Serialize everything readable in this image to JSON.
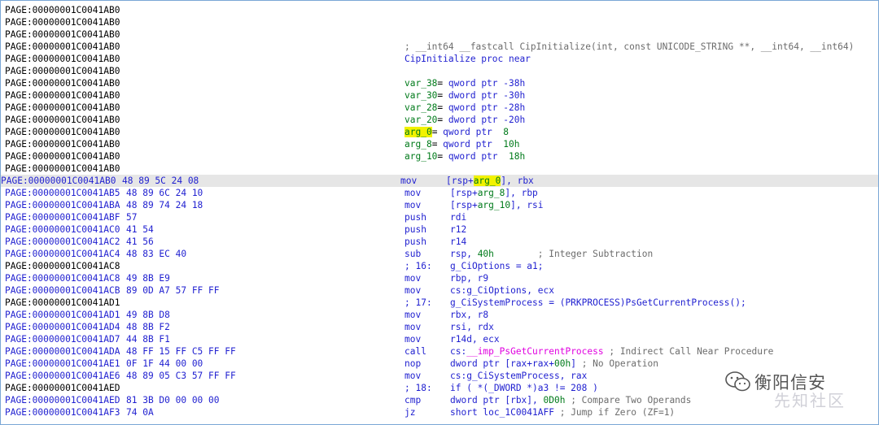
{
  "lines": [
    {
      "addr": "PAGE:00000001C0041AB0",
      "bytes": "",
      "cols": []
    },
    {
      "addr": "PAGE:00000001C0041AB0",
      "bytes": "",
      "cols": []
    },
    {
      "addr": "PAGE:00000001C0041AB0",
      "bytes": "",
      "cols": []
    },
    {
      "addr": "PAGE:00000001C0041AB0",
      "bytes": "",
      "cols": [
        {
          "col": "a",
          "parts": [
            {
              "t": "; __int64 __fastcall CipInitialize(int, const UNICODE_STRING **, __int64, __int64)",
              "c": "comment"
            }
          ]
        }
      ]
    },
    {
      "addr": "PAGE:00000001C0041AB0",
      "bytes": "",
      "cols": [
        {
          "col": "a",
          "parts": [
            {
              "t": "CipInitialize proc near",
              "c": "blue"
            }
          ]
        }
      ]
    },
    {
      "addr": "PAGE:00000001C0041AB0",
      "bytes": "",
      "cols": []
    },
    {
      "addr": "PAGE:00000001C0041AB0",
      "bytes": "",
      "cols": [
        {
          "col": "a",
          "parts": [
            {
              "t": "var_38",
              "c": "green"
            },
            {
              "t": "= ",
              "c": "black"
            },
            {
              "t": "qword ptr -38h",
              "c": "blue"
            }
          ]
        }
      ]
    },
    {
      "addr": "PAGE:00000001C0041AB0",
      "bytes": "",
      "cols": [
        {
          "col": "a",
          "parts": [
            {
              "t": "var_30",
              "c": "green"
            },
            {
              "t": "= ",
              "c": "black"
            },
            {
              "t": "dword ptr -30h",
              "c": "blue"
            }
          ]
        }
      ]
    },
    {
      "addr": "PAGE:00000001C0041AB0",
      "bytes": "",
      "cols": [
        {
          "col": "a",
          "parts": [
            {
              "t": "var_28",
              "c": "green"
            },
            {
              "t": "= ",
              "c": "black"
            },
            {
              "t": "qword ptr -28h",
              "c": "blue"
            }
          ]
        }
      ]
    },
    {
      "addr": "PAGE:00000001C0041AB0",
      "bytes": "",
      "cols": [
        {
          "col": "a",
          "parts": [
            {
              "t": "var_20",
              "c": "green"
            },
            {
              "t": "= ",
              "c": "black"
            },
            {
              "t": "dword ptr -20h",
              "c": "blue"
            }
          ]
        }
      ]
    },
    {
      "addr": "PAGE:00000001C0041AB0",
      "bytes": "",
      "cols": [
        {
          "col": "a",
          "parts": [
            {
              "t": "arg_0",
              "c": "green",
              "hl": true
            },
            {
              "t": "= ",
              "c": "black"
            },
            {
              "t": "qword ptr  ",
              "c": "blue"
            },
            {
              "t": "8",
              "c": "green"
            }
          ]
        }
      ]
    },
    {
      "addr": "PAGE:00000001C0041AB0",
      "bytes": "",
      "cols": [
        {
          "col": "a",
          "parts": [
            {
              "t": "arg_8",
              "c": "green"
            },
            {
              "t": "= ",
              "c": "black"
            },
            {
              "t": "qword ptr  ",
              "c": "blue"
            },
            {
              "t": "10h",
              "c": "green"
            }
          ]
        }
      ]
    },
    {
      "addr": "PAGE:00000001C0041AB0",
      "bytes": "",
      "cols": [
        {
          "col": "a",
          "parts": [
            {
              "t": "arg_10",
              "c": "green"
            },
            {
              "t": "= ",
              "c": "black"
            },
            {
              "t": "qword ptr  ",
              "c": "blue"
            },
            {
              "t": "18h",
              "c": "green"
            }
          ]
        }
      ]
    },
    {
      "addr": "PAGE:00000001C0041AB0",
      "bytes": "",
      "cols": []
    },
    {
      "addr": "PAGE:00000001C0041AB0",
      "bytes": "48 89 5C 24 08",
      "hl": true,
      "cols": [
        {
          "col": "a",
          "parts": [
            {
              "t": "mov",
              "c": "mnem"
            }
          ]
        },
        {
          "col": "b",
          "parts": [
            {
              "t": "[rsp+",
              "c": "blue"
            },
            {
              "t": "arg_0",
              "c": "green",
              "hl": true
            },
            {
              "t": "], rbx",
              "c": "blue"
            }
          ]
        }
      ]
    },
    {
      "addr": "PAGE:00000001C0041AB5",
      "bytes": "48 89 6C 24 10",
      "cols": [
        {
          "col": "a",
          "parts": [
            {
              "t": "mov",
              "c": "mnem"
            }
          ]
        },
        {
          "col": "b",
          "parts": [
            {
              "t": "[rsp+",
              "c": "blue"
            },
            {
              "t": "arg_8",
              "c": "green"
            },
            {
              "t": "], rbp",
              "c": "blue"
            }
          ]
        }
      ]
    },
    {
      "addr": "PAGE:00000001C0041ABA",
      "bytes": "48 89 74 24 18",
      "cols": [
        {
          "col": "a",
          "parts": [
            {
              "t": "mov",
              "c": "mnem"
            }
          ]
        },
        {
          "col": "b",
          "parts": [
            {
              "t": "[rsp+",
              "c": "blue"
            },
            {
              "t": "arg_10",
              "c": "green"
            },
            {
              "t": "], rsi",
              "c": "blue"
            }
          ]
        }
      ]
    },
    {
      "addr": "PAGE:00000001C0041ABF",
      "bytes": "57",
      "cols": [
        {
          "col": "a",
          "parts": [
            {
              "t": "push",
              "c": "mnem"
            }
          ]
        },
        {
          "col": "b",
          "parts": [
            {
              "t": "rdi",
              "c": "blue"
            }
          ]
        }
      ]
    },
    {
      "addr": "PAGE:00000001C0041AC0",
      "bytes": "41 54",
      "cols": [
        {
          "col": "a",
          "parts": [
            {
              "t": "push",
              "c": "mnem"
            }
          ]
        },
        {
          "col": "b",
          "parts": [
            {
              "t": "r12",
              "c": "blue"
            }
          ]
        }
      ]
    },
    {
      "addr": "PAGE:00000001C0041AC2",
      "bytes": "41 56",
      "cols": [
        {
          "col": "a",
          "parts": [
            {
              "t": "push",
              "c": "mnem"
            }
          ]
        },
        {
          "col": "b",
          "parts": [
            {
              "t": "r14",
              "c": "blue"
            }
          ]
        }
      ]
    },
    {
      "addr": "PAGE:00000001C0041AC4",
      "bytes": "48 83 EC 40",
      "cols": [
        {
          "col": "a",
          "parts": [
            {
              "t": "sub",
              "c": "mnem"
            }
          ]
        },
        {
          "col": "b",
          "parts": [
            {
              "t": "rsp, ",
              "c": "blue"
            },
            {
              "t": "40h",
              "c": "green"
            },
            {
              "t": "        ; Integer Subtraction",
              "c": "comment"
            }
          ]
        }
      ]
    },
    {
      "addr": "PAGE:00000001C0041AC8",
      "bytes": "",
      "cols": [
        {
          "col": "a",
          "parts": [
            {
              "t": "; 16:",
              "c": "blue"
            }
          ]
        },
        {
          "col": "b",
          "parts": [
            {
              "t": "g_CiOptions = a1;",
              "c": "blue"
            }
          ]
        }
      ]
    },
    {
      "addr": "PAGE:00000001C0041AC8",
      "bytes": "49 8B E9",
      "cols": [
        {
          "col": "a",
          "parts": [
            {
              "t": "mov",
              "c": "mnem"
            }
          ]
        },
        {
          "col": "b",
          "parts": [
            {
              "t": "rbp, r9",
              "c": "blue"
            }
          ]
        }
      ]
    },
    {
      "addr": "PAGE:00000001C0041ACB",
      "bytes": "89 0D A7 57 FF FF",
      "cols": [
        {
          "col": "a",
          "parts": [
            {
              "t": "mov",
              "c": "mnem"
            }
          ]
        },
        {
          "col": "b",
          "parts": [
            {
              "t": "cs:g_CiOptions, ecx",
              "c": "blue"
            }
          ]
        }
      ]
    },
    {
      "addr": "PAGE:00000001C0041AD1",
      "bytes": "",
      "cols": [
        {
          "col": "a",
          "parts": [
            {
              "t": "; 17:",
              "c": "blue"
            }
          ]
        },
        {
          "col": "b",
          "parts": [
            {
              "t": "g_CiSystemProcess = (PRKPROCESS)PsGetCurrentProcess();",
              "c": "blue"
            }
          ]
        }
      ]
    },
    {
      "addr": "PAGE:00000001C0041AD1",
      "bytes": "49 8B D8",
      "cols": [
        {
          "col": "a",
          "parts": [
            {
              "t": "mov",
              "c": "mnem"
            }
          ]
        },
        {
          "col": "b",
          "parts": [
            {
              "t": "rbx, r8",
              "c": "blue"
            }
          ]
        }
      ]
    },
    {
      "addr": "PAGE:00000001C0041AD4",
      "bytes": "48 8B F2",
      "cols": [
        {
          "col": "a",
          "parts": [
            {
              "t": "mov",
              "c": "mnem"
            }
          ]
        },
        {
          "col": "b",
          "parts": [
            {
              "t": "rsi, rdx",
              "c": "blue"
            }
          ]
        }
      ]
    },
    {
      "addr": "PAGE:00000001C0041AD7",
      "bytes": "44 8B F1",
      "cols": [
        {
          "col": "a",
          "parts": [
            {
              "t": "mov",
              "c": "mnem"
            }
          ]
        },
        {
          "col": "b",
          "parts": [
            {
              "t": "r14d, ecx",
              "c": "blue"
            }
          ]
        }
      ]
    },
    {
      "addr": "PAGE:00000001C0041ADA",
      "bytes": "48 FF 15 FF C5 FF FF",
      "cols": [
        {
          "col": "a",
          "parts": [
            {
              "t": "call",
              "c": "mnem"
            }
          ]
        },
        {
          "col": "b",
          "parts": [
            {
              "t": "cs:",
              "c": "blue"
            },
            {
              "t": "__imp_PsGetCurrentProcess",
              "c": "magenta"
            },
            {
              "t": " ; Indirect Call Near Procedure",
              "c": "comment"
            }
          ]
        }
      ]
    },
    {
      "addr": "PAGE:00000001C0041AE1",
      "bytes": "0F 1F 44 00 00",
      "cols": [
        {
          "col": "a",
          "parts": [
            {
              "t": "nop",
              "c": "mnem"
            }
          ]
        },
        {
          "col": "b",
          "parts": [
            {
              "t": "dword ptr [rax+rax+",
              "c": "blue"
            },
            {
              "t": "00h",
              "c": "green"
            },
            {
              "t": "] ",
              "c": "blue"
            },
            {
              "t": "; No Operation",
              "c": "comment"
            }
          ]
        }
      ]
    },
    {
      "addr": "PAGE:00000001C0041AE6",
      "bytes": "48 89 05 C3 57 FF FF",
      "cols": [
        {
          "col": "a",
          "parts": [
            {
              "t": "mov",
              "c": "mnem"
            }
          ]
        },
        {
          "col": "b",
          "parts": [
            {
              "t": "cs:g_CiSystemProcess, rax",
              "c": "blue"
            }
          ]
        }
      ]
    },
    {
      "addr": "PAGE:00000001C0041AED",
      "bytes": "",
      "cols": [
        {
          "col": "a",
          "parts": [
            {
              "t": "; 18:",
              "c": "blue"
            }
          ]
        },
        {
          "col": "b",
          "parts": [
            {
              "t": "if ( *(_DWORD *)a3 != 208 )",
              "c": "blue"
            }
          ]
        }
      ]
    },
    {
      "addr": "PAGE:00000001C0041AED",
      "bytes": "81 3B D0 00 00 00",
      "cols": [
        {
          "col": "a",
          "parts": [
            {
              "t": "cmp",
              "c": "mnem"
            }
          ]
        },
        {
          "col": "b",
          "parts": [
            {
              "t": "dword ptr [rbx], ",
              "c": "blue"
            },
            {
              "t": "0D0h",
              "c": "green"
            },
            {
              "t": " ; Compare Two Operands",
              "c": "comment"
            }
          ]
        }
      ]
    },
    {
      "addr": "PAGE:00000001C0041AF3",
      "bytes": "74 0A",
      "cols": [
        {
          "col": "a",
          "parts": [
            {
              "t": "jz",
              "c": "mnem"
            }
          ]
        },
        {
          "col": "b",
          "parts": [
            {
              "t": "short loc_1C0041AFF",
              "c": "blue"
            },
            {
              "t": " ; Jump if Zero (ZF=1)",
              "c": "comment"
            }
          ]
        }
      ]
    }
  ],
  "watermark": {
    "text": "衡阳信安",
    "sub": "先知社区",
    "icon": "wechat-icon"
  }
}
